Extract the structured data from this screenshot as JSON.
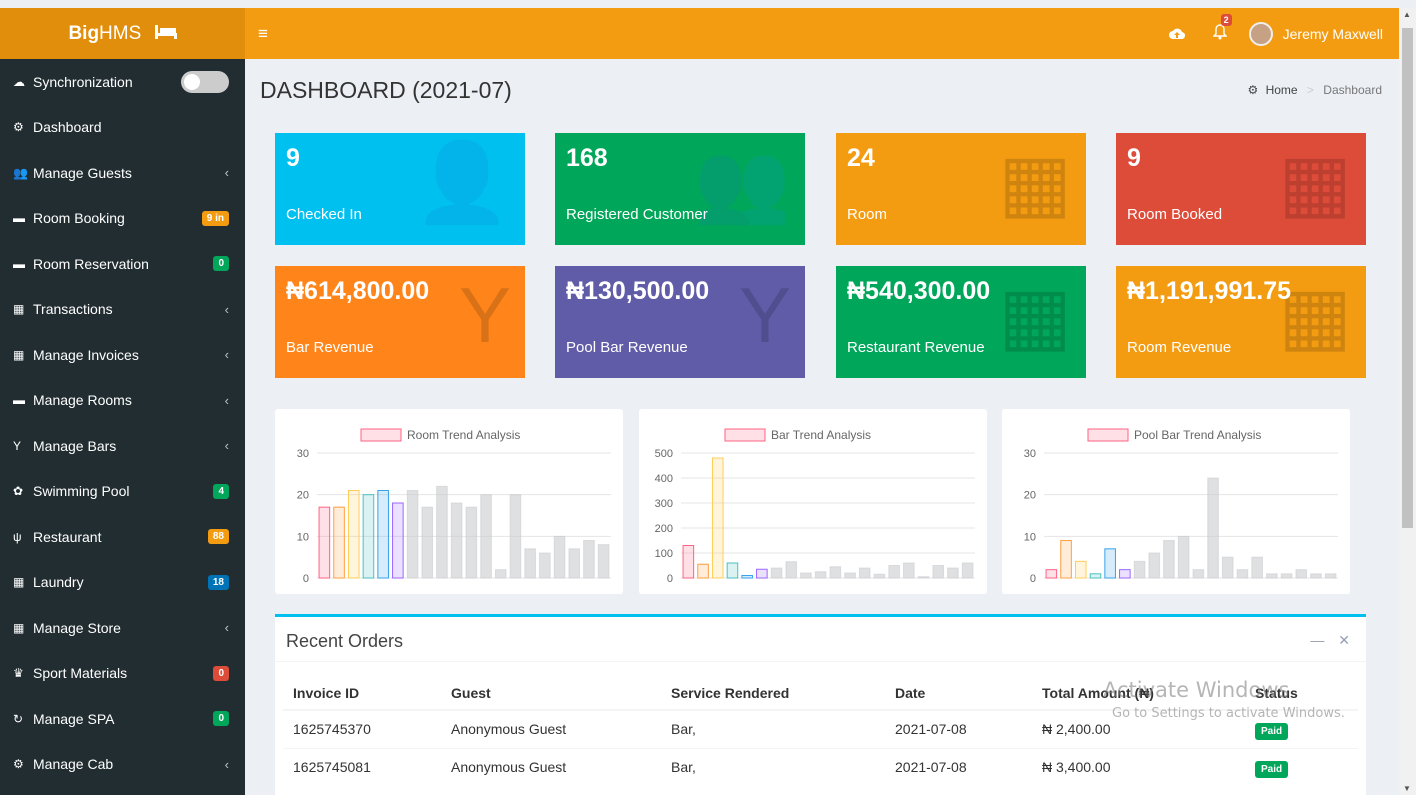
{
  "app": {
    "logo_bold": "Big",
    "logo_light": "HMS",
    "logo_icon": "bed-icon"
  },
  "topbar": {
    "menu_glyph": "≡",
    "notifications_count": "2",
    "user_name": "Jeremy Maxwell"
  },
  "page": {
    "title": "DASHBOARD (2021-07)",
    "breadcrumb": {
      "home": "Home",
      "current": "Dashboard"
    }
  },
  "sidebar": {
    "items": [
      {
        "label": "Synchronization",
        "icon": "cloud-icon"
      },
      {
        "label": "Dashboard",
        "icon": "dashboard-icon"
      },
      {
        "label": "Manage Guests",
        "icon": "users-icon",
        "arrow": "‹"
      },
      {
        "label": "Room Booking",
        "icon": "bed-icon",
        "badge": "9 in",
        "badge_color": "#f39c12"
      },
      {
        "label": "Room Reservation",
        "icon": "bed-icon",
        "badge": "0",
        "badge_color": "#00a65a"
      },
      {
        "label": "Transactions",
        "icon": "table-icon",
        "arrow": "‹"
      },
      {
        "label": "Manage Invoices",
        "icon": "table-icon",
        "arrow": "‹"
      },
      {
        "label": "Manage Rooms",
        "icon": "bed-icon",
        "arrow": "‹"
      },
      {
        "label": "Manage Bars",
        "icon": "glass-icon",
        "arrow": "‹"
      },
      {
        "label": "Swimming Pool",
        "icon": "gear-icon",
        "badge": "4",
        "badge_color": "#00a65a"
      },
      {
        "label": "Restaurant",
        "icon": "cutlery-icon",
        "badge": "88",
        "badge_color": "#f39c12"
      },
      {
        "label": "Laundry",
        "icon": "table-icon",
        "badge": "18",
        "badge_color": "#0073b7"
      },
      {
        "label": "Manage Store",
        "icon": "table-icon",
        "arrow": "‹"
      },
      {
        "label": "Sport Materials",
        "icon": "trophy-icon",
        "badge": "0",
        "badge_color": "#dd4b39"
      },
      {
        "label": "Manage SPA",
        "icon": "refresh-icon",
        "badge": "0",
        "badge_color": "#00a65a"
      },
      {
        "label": "Manage Cab",
        "icon": "cogs-icon",
        "arrow": "‹"
      }
    ]
  },
  "stats": [
    {
      "value": "9",
      "label": "Checked In",
      "color": "#00c0ef",
      "icon": "user-plus-icon"
    },
    {
      "value": "168",
      "label": "Registered Customer",
      "color": "#00a65a",
      "icon": "users-icon"
    },
    {
      "value": "24",
      "label": "Room",
      "color": "#f39c12",
      "icon": "building-icon"
    },
    {
      "value": "9",
      "label": "Room Booked",
      "color": "#dd4b39",
      "icon": "building-icon"
    },
    {
      "value": "₦614,800.00",
      "label": "Bar Revenue",
      "color": "#ff851b",
      "icon": "glass-icon"
    },
    {
      "value": "₦130,500.00",
      "label": "Pool Bar Revenue",
      "color": "#605ca8",
      "icon": "glass-icon"
    },
    {
      "value": "₦540,300.00",
      "label": "Restaurant Revenue",
      "color": "#00a65a",
      "icon": "table-icon"
    },
    {
      "value": "₦1,191,991.75",
      "label": "Room Revenue",
      "color": "#f39c12",
      "icon": "table-icon"
    }
  ],
  "chart_data": [
    {
      "type": "bar",
      "title": "Room Trend Analysis",
      "ylim": [
        0,
        30
      ],
      "yticks": [
        0,
        10,
        20,
        30
      ],
      "values": [
        17,
        17,
        21,
        20,
        21,
        18,
        21,
        17,
        22,
        18,
        17,
        20,
        2,
        20,
        7,
        6,
        10,
        7,
        9,
        8
      ]
    },
    {
      "type": "bar",
      "title": "Bar Trend Analysis",
      "ylim": [
        0,
        500
      ],
      "yticks": [
        0,
        100,
        200,
        300,
        400,
        500
      ],
      "values": [
        130,
        55,
        480,
        60,
        10,
        35,
        40,
        65,
        20,
        25,
        45,
        20,
        40,
        15,
        50,
        60,
        5,
        50,
        40,
        60
      ]
    },
    {
      "type": "bar",
      "title": "Pool Bar Trend Analysis",
      "ylim": [
        0,
        30
      ],
      "yticks": [
        0,
        10,
        20,
        30
      ],
      "values": [
        2,
        9,
        4,
        1,
        7,
        2,
        4,
        6,
        9,
        10,
        2,
        24,
        5,
        2,
        5,
        1,
        1,
        2,
        1,
        1
      ]
    }
  ],
  "orders": {
    "title": "Recent Orders",
    "columns": [
      "Invoice ID",
      "Guest",
      "Service Rendered",
      "Date",
      "Total Amount (₦)",
      "Status"
    ],
    "rows": [
      {
        "id": "1625745370",
        "guest": "Anonymous Guest",
        "service": "Bar,",
        "date": "2021-07-08",
        "amount": "₦ 2,400.00",
        "status": "Paid"
      },
      {
        "id": "1625745081",
        "guest": "Anonymous Guest",
        "service": "Bar,",
        "date": "2021-07-08",
        "amount": "₦ 3,400.00",
        "status": "Paid"
      }
    ]
  },
  "watermark": {
    "line1": "Activate Windows",
    "line2": "Go to Settings to activate Windows."
  }
}
